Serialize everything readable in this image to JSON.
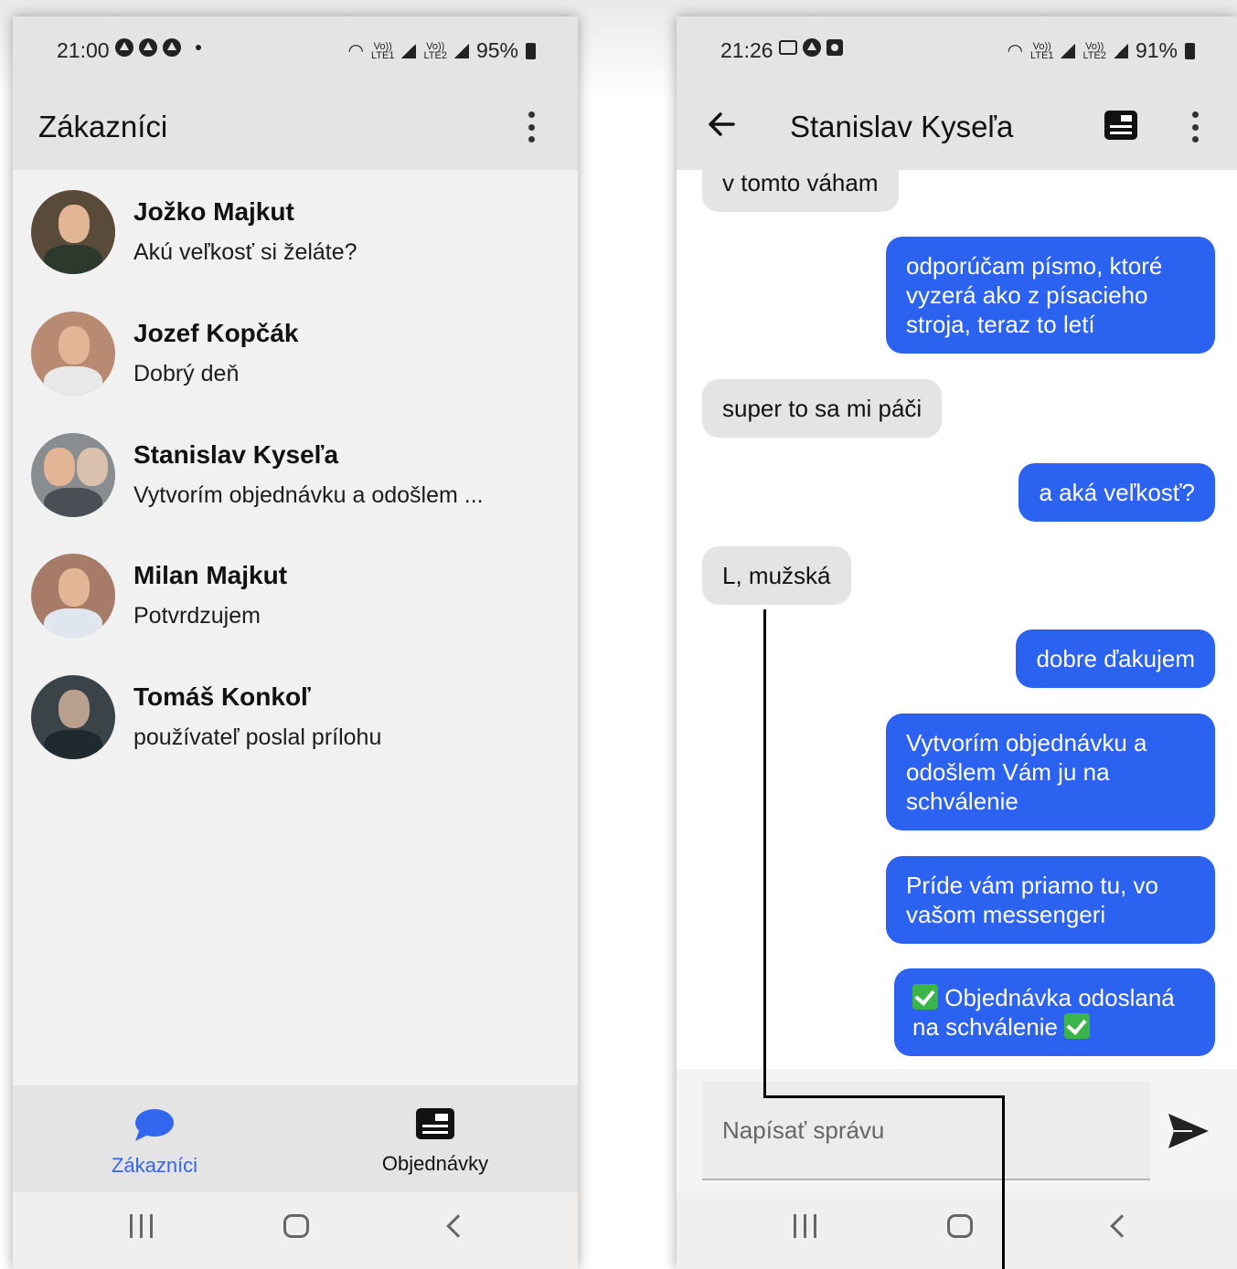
{
  "left": {
    "status": {
      "time": "21:00",
      "battery": "95%"
    },
    "title": "Zákazníci",
    "customers": [
      {
        "name": "Jožko Majkut",
        "message": "Akú veľkosť si želáte?"
      },
      {
        "name": "Jozef Kopčák",
        "message": "Dobrý deň"
      },
      {
        "name": "Stanislav Kyseľa",
        "message": "Vytvorím objednávku a odošlem ..."
      },
      {
        "name": "Milan Majkut",
        "message": "Potvrdzujem"
      },
      {
        "name": "Tomáš Konkoľ",
        "message": "používateľ poslal prílohu"
      }
    ],
    "nav": {
      "customers": "Zákazníci",
      "orders": "Objednávky"
    }
  },
  "right": {
    "status": {
      "time": "21:26",
      "battery": "91%"
    },
    "title": "Stanislav Kyseľa",
    "messages": [
      {
        "from": "customer",
        "text": "v tomto váham"
      },
      {
        "from": "me",
        "text": "odporúčam písmo, ktoré vyzerá ako z písacieho stroja, teraz to letí"
      },
      {
        "from": "customer",
        "text": "super to sa mi páči"
      },
      {
        "from": "me",
        "text": "a aká veľkosť?"
      },
      {
        "from": "customer",
        "text": "L, mužská"
      },
      {
        "from": "me",
        "text": "dobre ďakujem"
      },
      {
        "from": "me",
        "text": "Vytvorím objednávku a odošlem Vám ju na schválenie"
      },
      {
        "from": "me",
        "text": "Príde vám priamo tu, vo vašom messengeri"
      },
      {
        "from": "me",
        "text_before": "Objednávka odoslaná na schválenie",
        "text_after": ""
      }
    ],
    "composer": {
      "placeholder": "Napísať správu"
    }
  },
  "colors": {
    "accent": "#2c62f0",
    "nav_active": "#3366ee",
    "bar_bg": "#e4e4e4"
  },
  "icons": [
    "chat-bubble-icon",
    "order-card-icon",
    "back-arrow-icon",
    "send-icon",
    "kebab-menu-icon",
    "check-emoji-icon"
  ]
}
